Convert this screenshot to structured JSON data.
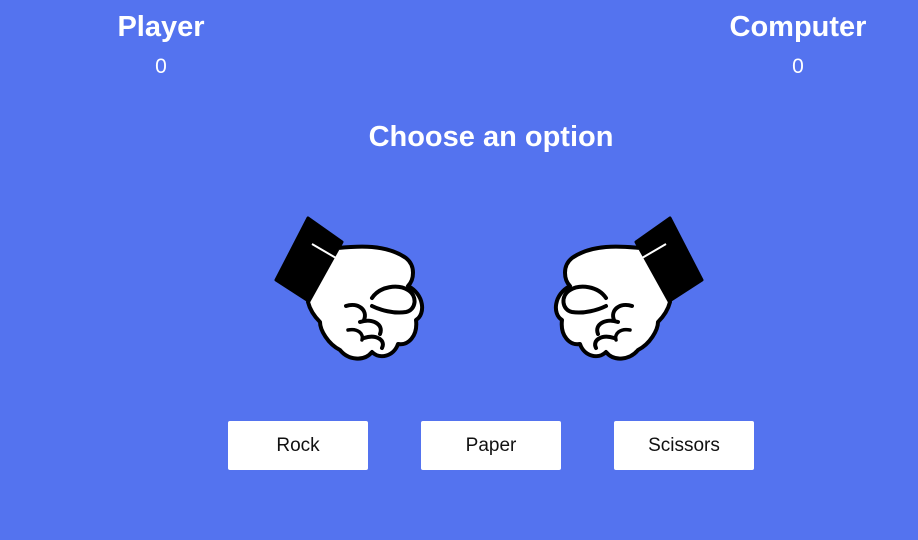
{
  "player": {
    "title": "Player",
    "score": "0",
    "hand_icon": "rock-fist-icon"
  },
  "computer": {
    "title": "Computer",
    "score": "0",
    "hand_icon": "rock-fist-icon"
  },
  "prompt": "Choose an option",
  "buttons": {
    "rock": "Rock",
    "paper": "Paper",
    "scissors": "Scissors"
  },
  "colors": {
    "background": "#5473ef",
    "button_bg": "#ffffff",
    "text": "#ffffff"
  }
}
